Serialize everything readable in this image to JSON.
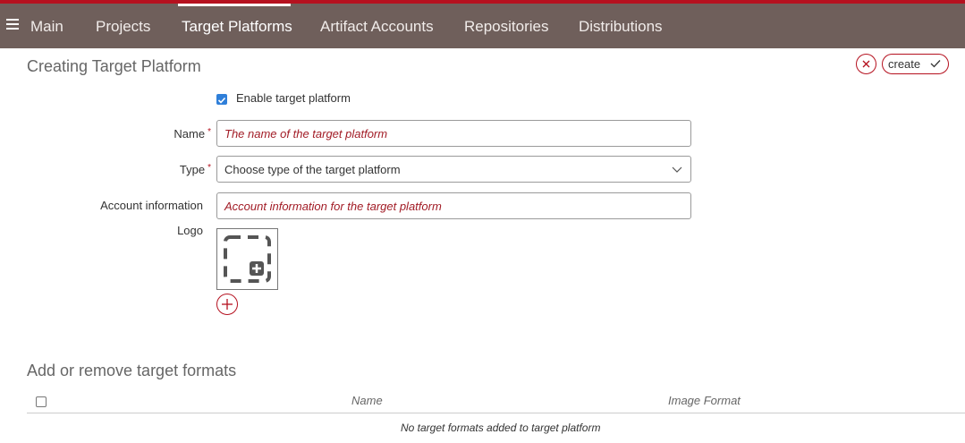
{
  "nav": {
    "items": [
      {
        "label": "Main"
      },
      {
        "label": "Projects"
      },
      {
        "label": "Target Platforms"
      },
      {
        "label": "Artifact Accounts"
      },
      {
        "label": "Repositories"
      },
      {
        "label": "Distributions"
      }
    ],
    "active": "Target Platforms",
    "menu_icon": "hamburger-icon"
  },
  "colors": {
    "accent": "#b5111f",
    "navbar": "#6f5f5b",
    "checkbox": "#2f7fd9"
  },
  "page": {
    "title": "Creating Target Platform",
    "cancel_icon": "close-icon",
    "create_label": "create",
    "create_icon": "check-icon"
  },
  "form": {
    "enable_label": "Enable target platform",
    "enable_checked": true,
    "name_label": "Name",
    "name_placeholder": "The name of the target platform",
    "type_label": "Type",
    "type_value": "Choose type of the target platform",
    "account_label": "Account information",
    "account_placeholder": "Account information for the target platform",
    "logo_label": "Logo",
    "required_mark": "*"
  },
  "formats": {
    "title": "Add or remove target formats",
    "columns": [
      "Name",
      "Image Format"
    ],
    "empty_text": "No target formats added to target platform"
  }
}
